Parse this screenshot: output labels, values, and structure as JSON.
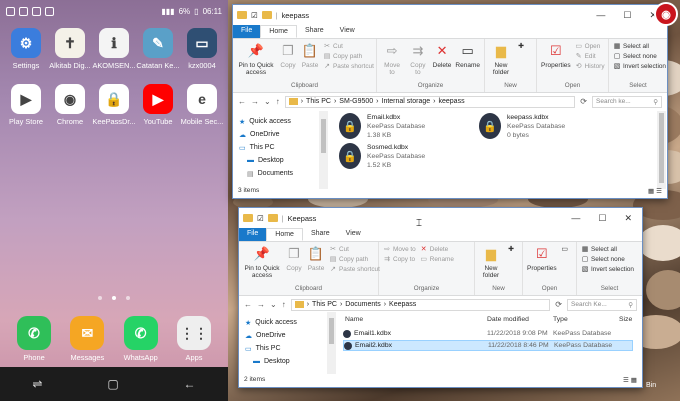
{
  "phone": {
    "status": {
      "battery": "6%",
      "time": "06:11"
    },
    "apps": [
      {
        "label": "Settings",
        "icon": "gear-icon",
        "color": "#3b7ddd",
        "glyph": "⚙"
      },
      {
        "label": "Alkitab Dig...",
        "icon": "bible-icon",
        "color": "#f4f1e8",
        "glyph": "✝"
      },
      {
        "label": "AKOMSEN...",
        "icon": "info-icon",
        "color": "#f4f4f4",
        "glyph": "ℹ"
      },
      {
        "label": "Catatan Ke...",
        "icon": "notes-icon",
        "color": "#5aa0c8",
        "glyph": "✎"
      },
      {
        "label": "kzx0004",
        "icon": "kzx-icon",
        "color": "#2f4f73",
        "glyph": "▭"
      },
      {
        "label": "Play Store",
        "icon": "play-store-icon",
        "color": "#ffffff",
        "glyph": "▶"
      },
      {
        "label": "Chrome",
        "icon": "chrome-icon",
        "color": "#ffffff",
        "glyph": "◉"
      },
      {
        "label": "KeePassDr...",
        "icon": "keepass-icon",
        "color": "#ffffff",
        "glyph": "🔒"
      },
      {
        "label": "YouTube",
        "icon": "youtube-icon",
        "color": "#ff0000",
        "glyph": "▶"
      },
      {
        "label": "Mobile Sec...",
        "icon": "eset-icon",
        "color": "#ffffff",
        "glyph": "e"
      }
    ],
    "dock": [
      {
        "label": "Phone",
        "icon": "phone-icon",
        "color": "#2fbf59",
        "glyph": "✆"
      },
      {
        "label": "Messages",
        "icon": "messages-icon",
        "color": "#f5a623",
        "glyph": "✉"
      },
      {
        "label": "WhatsApp",
        "icon": "whatsapp-icon",
        "color": "#25d366",
        "glyph": "✆"
      },
      {
        "label": "Apps",
        "icon": "apps-grid-icon",
        "color": "#eeeeee",
        "glyph": "⋮⋮"
      }
    ]
  },
  "ribbon": {
    "tabs": [
      "File",
      "Home",
      "Share",
      "View"
    ],
    "pin": "Pin to Quick access",
    "copy": "Copy",
    "paste": "Paste",
    "cut": "Cut",
    "copy_path": "Copy path",
    "paste_shortcut": "Paste shortcut",
    "move_to": "Move to",
    "copy_to": "Copy to",
    "delete": "Delete",
    "rename": "Rename",
    "new_folder": "New folder",
    "properties": "Properties",
    "open": "Open",
    "edit": "Edit",
    "history": "History",
    "select_all": "Select all",
    "select_none": "Select none",
    "invert_selection": "Invert selection",
    "groups": {
      "clipboard": "Clipboard",
      "organize": "Organize",
      "new": "New",
      "open": "Open",
      "select": "Select"
    }
  },
  "window1": {
    "title": "keepass",
    "path": [
      "This PC",
      "SM-G9500",
      "Internal storage",
      "keepass"
    ],
    "search_placeholder": "Search ke...",
    "nav": [
      "Quick access",
      "OneDrive",
      "This PC",
      "Desktop",
      "Documents"
    ],
    "files": [
      {
        "name": "Email.kdbx",
        "type": "KeePass Database",
        "size": "1.38 KB"
      },
      {
        "name": "keepass.kdbx",
        "type": "KeePass Database",
        "size": "0 bytes"
      },
      {
        "name": "Sosmed.kdbx",
        "type": "KeePass Database",
        "size": "1.52 KB"
      }
    ],
    "status": "3 items"
  },
  "window2": {
    "title": "Keepass",
    "path": [
      "This PC",
      "Documents",
      "Keepass"
    ],
    "search_placeholder": "Search Ke...",
    "nav": [
      "Quick access",
      "OneDrive",
      "This PC",
      "Desktop"
    ],
    "columns": [
      "Name",
      "Date modified",
      "Type",
      "Size"
    ],
    "rows": [
      {
        "name": "Email1.kdbx",
        "date": "11/22/2018 9:08 PM",
        "type": "KeePass Database"
      },
      {
        "name": "Email2.kdbx",
        "date": "11/22/2018 8:46 PM",
        "type": "KeePass Database"
      }
    ],
    "status": "2 items"
  },
  "desktop": {
    "bin_label": "Bin"
  }
}
